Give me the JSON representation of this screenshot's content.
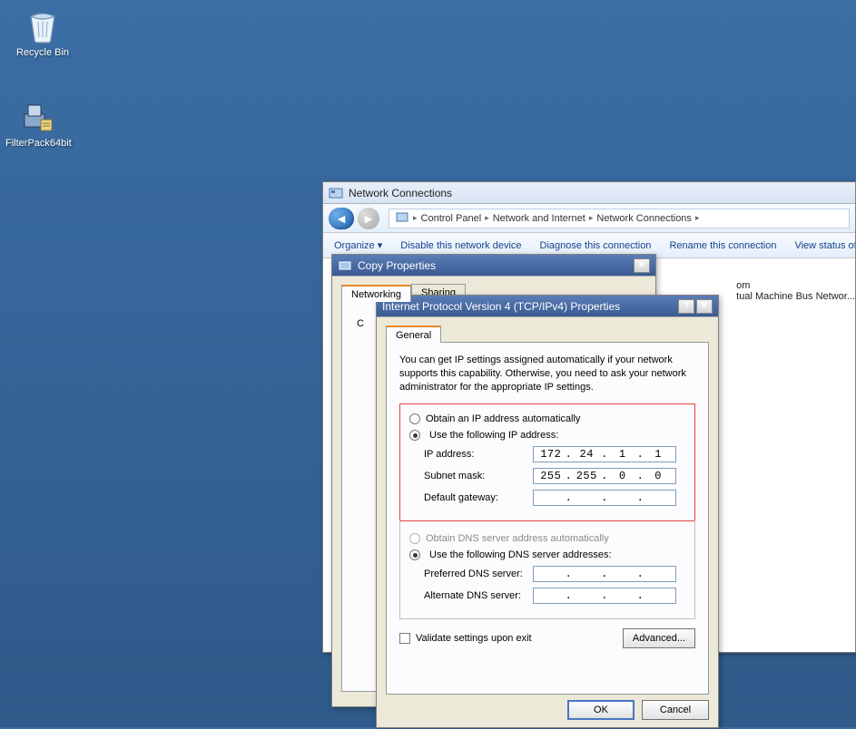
{
  "desktop": {
    "recycle_label": "Recycle Bin",
    "filterpack_label": "FilterPack64bit"
  },
  "netwin": {
    "title": "Network Connections",
    "breadcrumb": {
      "arrow": "▸",
      "parts": [
        "Control Panel",
        "Network and Internet",
        "Network Connections"
      ]
    },
    "cmdbar": {
      "organize": "Organize ▾",
      "disable": "Disable this network device",
      "diagnose": "Diagnose this connection",
      "rename": "Rename this connection",
      "viewstatus": "View status of this c"
    },
    "right_text_1": "om",
    "right_text_2": "tual Machine Bus Networ..."
  },
  "copyprop": {
    "title": "Copy Properties",
    "tabs": {
      "networking": "Networking",
      "sharing": "Sharing"
    },
    "connect_label": "C"
  },
  "ipv4": {
    "title": "Internet Protocol Version 4 (TCP/IPv4) Properties",
    "tab_general": "General",
    "description": "You can get IP settings assigned automatically if your network supports this capability. Otherwise, you need to ask your network administrator for the appropriate IP settings.",
    "ip_group": {
      "obtain_auto": "Obtain an IP address automatically",
      "use_following": "Use the following IP address:",
      "ip_label": "IP address:",
      "ip": [
        "172",
        "24",
        "1",
        "1"
      ],
      "subnet_label": "Subnet mask:",
      "subnet": [
        "255",
        "255",
        "0",
        "0"
      ],
      "gateway_label": "Default gateway:",
      "gateway": [
        "",
        "",
        "",
        ""
      ]
    },
    "dns_group": {
      "obtain_auto": "Obtain DNS server address automatically",
      "use_following": "Use the following DNS server addresses:",
      "preferred_label": "Preferred DNS server:",
      "preferred": [
        "",
        "",
        "",
        ""
      ],
      "alternate_label": "Alternate DNS server:",
      "alternate": [
        "",
        "",
        "",
        ""
      ]
    },
    "validate_label": "Validate settings upon exit",
    "advanced": "Advanced...",
    "ok": "OK",
    "cancel": "Cancel",
    "help": "?",
    "close": "✕"
  }
}
